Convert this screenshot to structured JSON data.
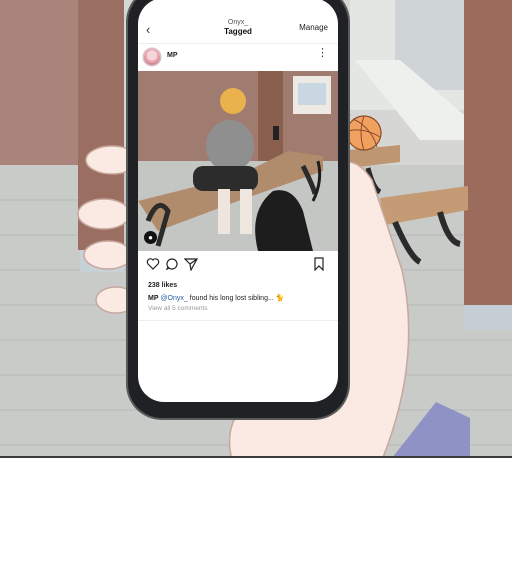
{
  "header": {
    "username": "Onyx_",
    "title": "Tagged",
    "manage_label": "Manage"
  },
  "post": {
    "poster": "MP",
    "likes": "238 likes",
    "caption_author": "MP",
    "caption_mention": "@Onyx_",
    "caption_text": "found his long lost sibling...",
    "view_comments": "View all 5 comments"
  },
  "icons": [
    "back-icon",
    "more-icon",
    "heart-icon",
    "comment-icon",
    "share-icon",
    "bookmark-icon",
    "user-tag-icon",
    "cat-emoji-icon"
  ]
}
